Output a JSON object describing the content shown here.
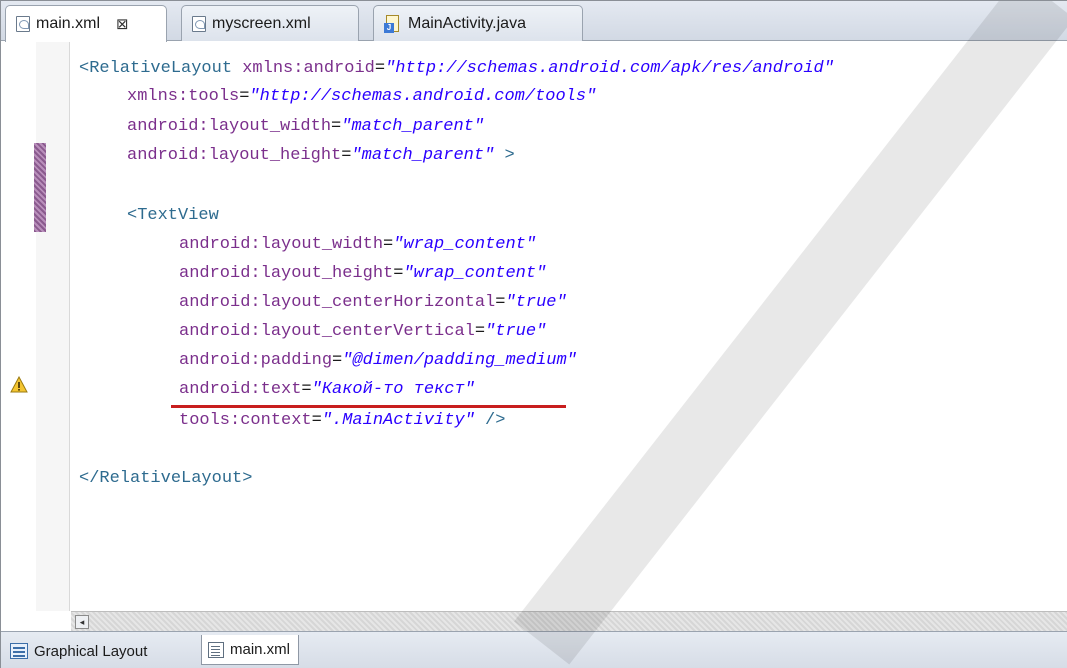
{
  "tabs": [
    {
      "label": "main.xml",
      "active": true,
      "closable": true,
      "icon": "xml-file-icon"
    },
    {
      "label": "myscreen.xml",
      "active": false,
      "icon": "xml-file-icon"
    },
    {
      "label": "MainActivity.java",
      "active": false,
      "icon": "java-file-icon"
    }
  ],
  "close_glyph": "⊠",
  "code": {
    "line1": {
      "open": "<RelativeLayout ",
      "attr": "xmlns:android",
      "eq": "=",
      "val": "\"http://schemas.android.com/apk/res/android\""
    },
    "line2": {
      "attr": "xmlns:tools",
      "eq": "=",
      "val": "\"http://schemas.android.com/tools\""
    },
    "line3": {
      "attr": "android:layout_width",
      "eq": "=",
      "val": "\"match_parent\""
    },
    "line4": {
      "attr": "android:layout_height",
      "eq": "=",
      "val": "\"match_parent\"",
      "close": " >"
    },
    "line6": {
      "open": "<TextView"
    },
    "line7": {
      "attr": "android:layout_width",
      "eq": "=",
      "val": "\"wrap_content\""
    },
    "line8": {
      "attr": "android:layout_height",
      "eq": "=",
      "val": "\"wrap_content\""
    },
    "line9": {
      "attr": "android:layout_centerHorizontal",
      "eq": "=",
      "val": "\"true\""
    },
    "line10": {
      "attr": "android:layout_centerVertical",
      "eq": "=",
      "val": "\"true\""
    },
    "line11": {
      "attr": "android:padding",
      "eq": "=",
      "val": "\"@dimen/padding_medium\""
    },
    "line12": {
      "attr": "android:text",
      "eq": "=",
      "val": "\"Какой-то текст\""
    },
    "line13": {
      "attr": "tools:context",
      "eq": "=",
      "val": "\".MainActivity\"",
      "close": " />"
    },
    "line15": {
      "close_tag": "</RelativeLayout>"
    }
  },
  "bottom_tabs": [
    {
      "label": "Graphical Layout",
      "active": false,
      "icon": "layout-icon"
    },
    {
      "label": "main.xml",
      "active": true,
      "icon": "xml-source-icon"
    }
  ],
  "scroll_left_glyph": "◂",
  "colors": {
    "tag": "#2e6b8f",
    "attribute": "#7b2f8c",
    "value": "#2a00ff",
    "error_underline": "#c81e1e",
    "current_line": "#e8f2fe"
  }
}
